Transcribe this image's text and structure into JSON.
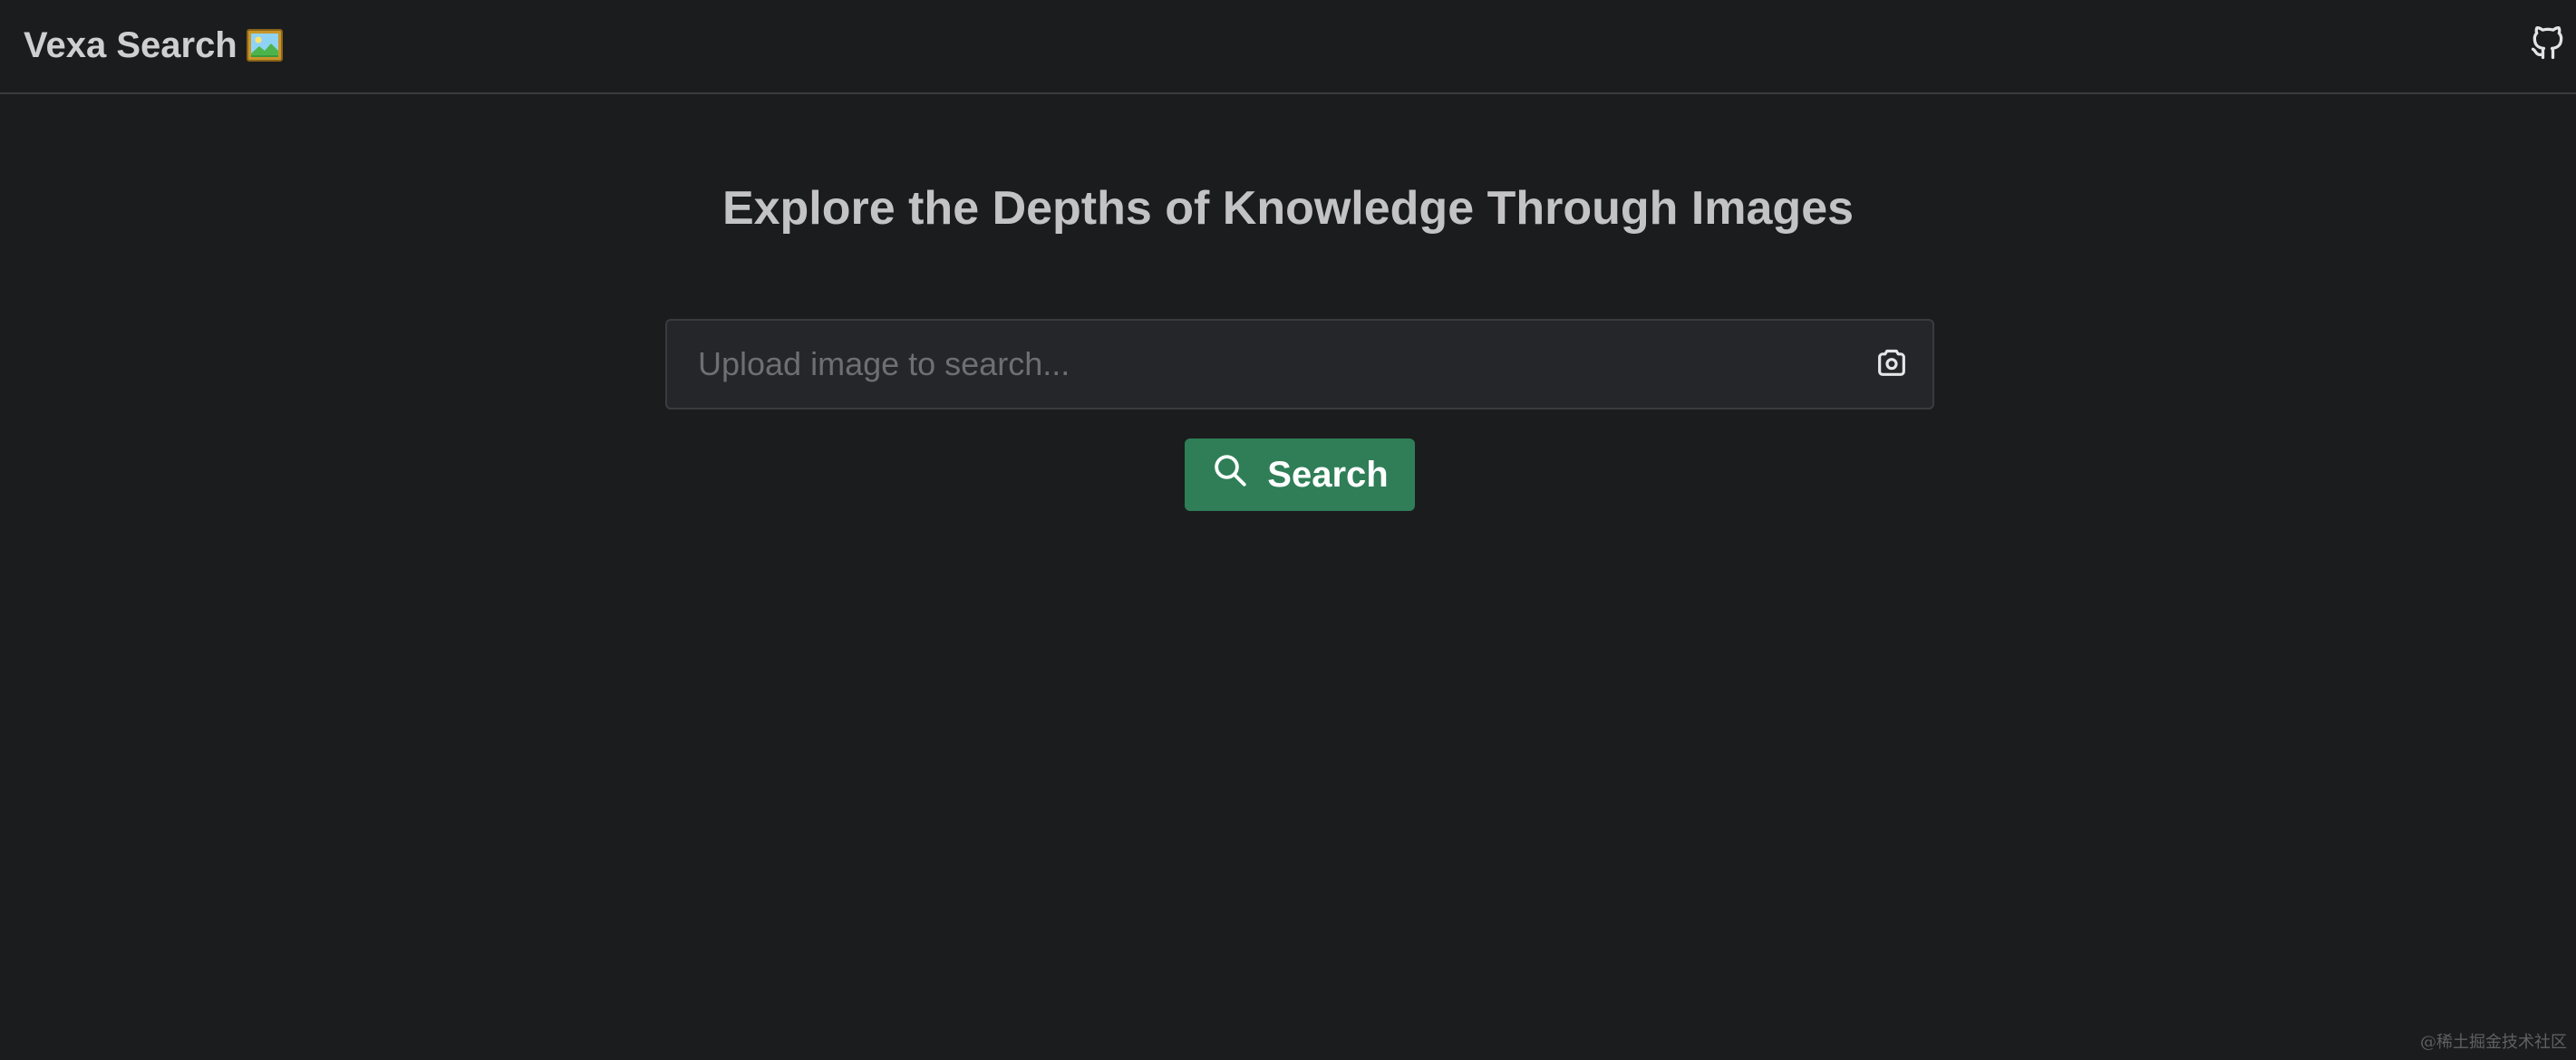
{
  "header": {
    "brand_title": "Vexa Search",
    "brand_icon": "framed-picture-icon",
    "github_icon": "github-icon"
  },
  "main": {
    "title": "Explore the Depths of Knowledge Through Images",
    "search": {
      "value": "",
      "placeholder": "Upload image to search...",
      "upload_icon": "camera-icon"
    },
    "search_button": {
      "label": "Search",
      "icon": "search-icon"
    }
  },
  "watermark": "@稀土掘金技术社区",
  "colors": {
    "background": "#1b1c1e",
    "accent": "#2f7e57",
    "input_background": "#25262a"
  }
}
